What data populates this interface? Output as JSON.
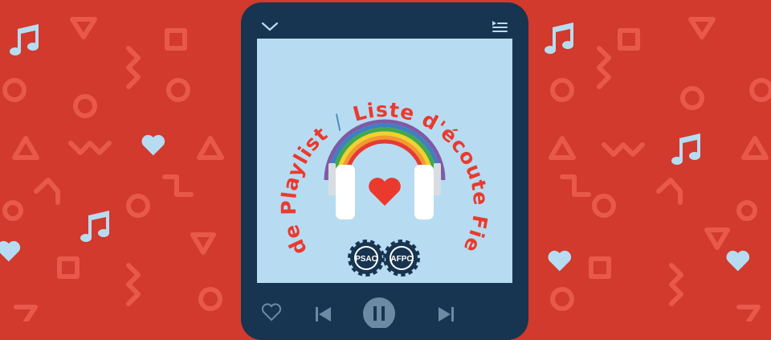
{
  "colors": {
    "background": "#d13a2c",
    "pattern": "#e8594a",
    "phone": "#173450",
    "screen": "#b7dcf2",
    "accent": "#ea3a2e",
    "icon_light": "#b7dcf2"
  },
  "cover": {
    "title_en": "Pride Playlist",
    "separator": "/",
    "title_fr": "Liste d'écoute Fierté",
    "logo_left": "PSAC",
    "logo_right": "AFPC"
  },
  "icons": {
    "collapse": "chevron-down-icon",
    "queue": "queue-icon",
    "like": "heart-outline-icon",
    "previous": "skip-previous-icon",
    "play_pause": "pause-icon",
    "next": "skip-next-icon"
  }
}
